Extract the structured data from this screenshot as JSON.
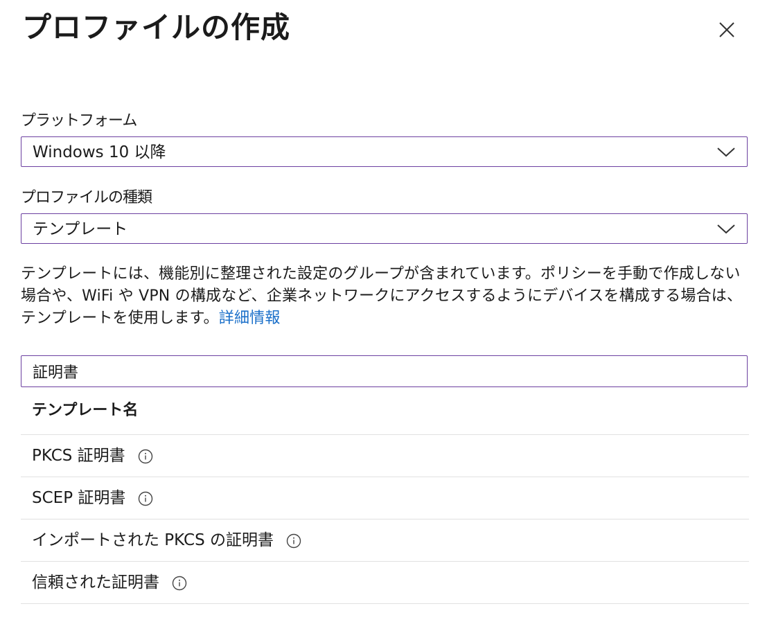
{
  "header": {
    "title": "プロファイルの作成",
    "close_icon": "close-icon"
  },
  "platform": {
    "label": "プラットフォーム",
    "value": "Windows 10 以降",
    "icon": "chevron-down-icon"
  },
  "profile_type": {
    "label": "プロファイルの種類",
    "value": "テンプレート",
    "icon": "chevron-down-icon"
  },
  "description": {
    "text": "テンプレートには、機能別に整理された設定のグループが含まれています。ポリシーを手動で作成しない場合や、WiFi や VPN の構成など、企業ネットワークにアクセスするようにデバイスを構成する場合は、テンプレートを使用します。",
    "link": "詳細情報"
  },
  "search": {
    "value": "証明書",
    "placeholder": ""
  },
  "table": {
    "header": "テンプレート名",
    "rows": [
      {
        "label": "PKCS 証明書",
        "icon": "info-icon"
      },
      {
        "label": "SCEP 証明書",
        "icon": "info-icon"
      },
      {
        "label": "インポートされた PKCS の証明書",
        "icon": "info-icon"
      },
      {
        "label": "信頼された証明書",
        "icon": "info-icon"
      }
    ]
  },
  "colors": {
    "accent_border": "#6b3fa0",
    "link": "#1a6fc9",
    "divider": "#e1e1e1",
    "text": "#1b1b1b"
  }
}
